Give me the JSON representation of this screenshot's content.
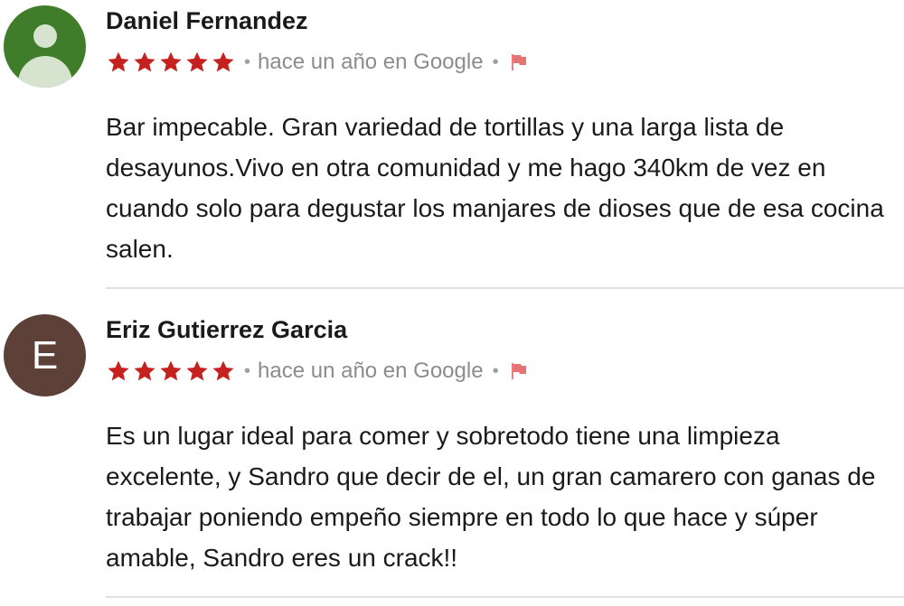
{
  "reviews": [
    {
      "author": "Daniel Fernandez",
      "avatar": "user-silhouette",
      "avatar_color": "#3f7d2b",
      "rating": 5,
      "rating_max": 5,
      "star_color": "#c5221f",
      "time_source": "hace un año en Google",
      "separator": "•",
      "flag_icon": "flag-icon",
      "flag_color": "#e57373",
      "text": "Bar impecable. Gran variedad de tortillas y una larga lista de desayunos.Vivo en otra comunidad y me hago 340km de vez en cuando solo para degustar los manjares de dioses que de esa cocina salen."
    },
    {
      "author": "Eriz Gutierrez Garcia",
      "avatar": "E",
      "avatar_color": "#5d4037",
      "rating": 5,
      "rating_max": 5,
      "star_color": "#c5221f",
      "time_source": "hace un año en Google",
      "separator": "•",
      "flag_icon": "flag-icon",
      "flag_color": "#e57373",
      "text": "Es un lugar ideal para comer y sobretodo tiene una limpieza excelente, y Sandro que decir de el, un gran camarero con ganas de trabajar poniendo empeño siempre en todo lo que hace y súper amable, Sandro eres un crack!!"
    }
  ]
}
